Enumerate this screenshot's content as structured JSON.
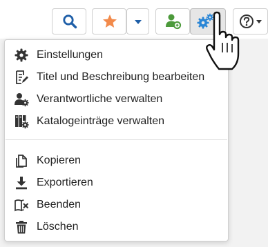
{
  "toolbar": {
    "search_icon": "search-icon",
    "favorite_icon": "star-icon",
    "dropdown_icon": "caret-down-icon",
    "user_icon": "user-icon",
    "settings_icon": "cogs-icon",
    "help_icon": "question-circle-icon"
  },
  "menu": {
    "items": [
      {
        "label": "Einstellungen",
        "icon": "gear-icon"
      },
      {
        "label": "Titel und Beschreibung bearbeiten",
        "icon": "edit-document-icon"
      },
      {
        "label": "Verantwortliche verwalten",
        "icon": "user-gear-icon"
      },
      {
        "label": "Katalogeinträge verwalten",
        "icon": "catalog-gear-icon"
      },
      {
        "label": "Kopieren",
        "icon": "copy-icon"
      },
      {
        "label": "Exportieren",
        "icon": "download-icon"
      },
      {
        "label": "Beenden",
        "icon": "close-book-icon"
      },
      {
        "label": "Löschen",
        "icon": "trash-icon"
      }
    ]
  },
  "colors": {
    "accent_blue": "#1f5fa8",
    "star_orange": "#f28a4b",
    "user_green": "#4c9a3b",
    "cog_blue": "#2a86d6"
  }
}
